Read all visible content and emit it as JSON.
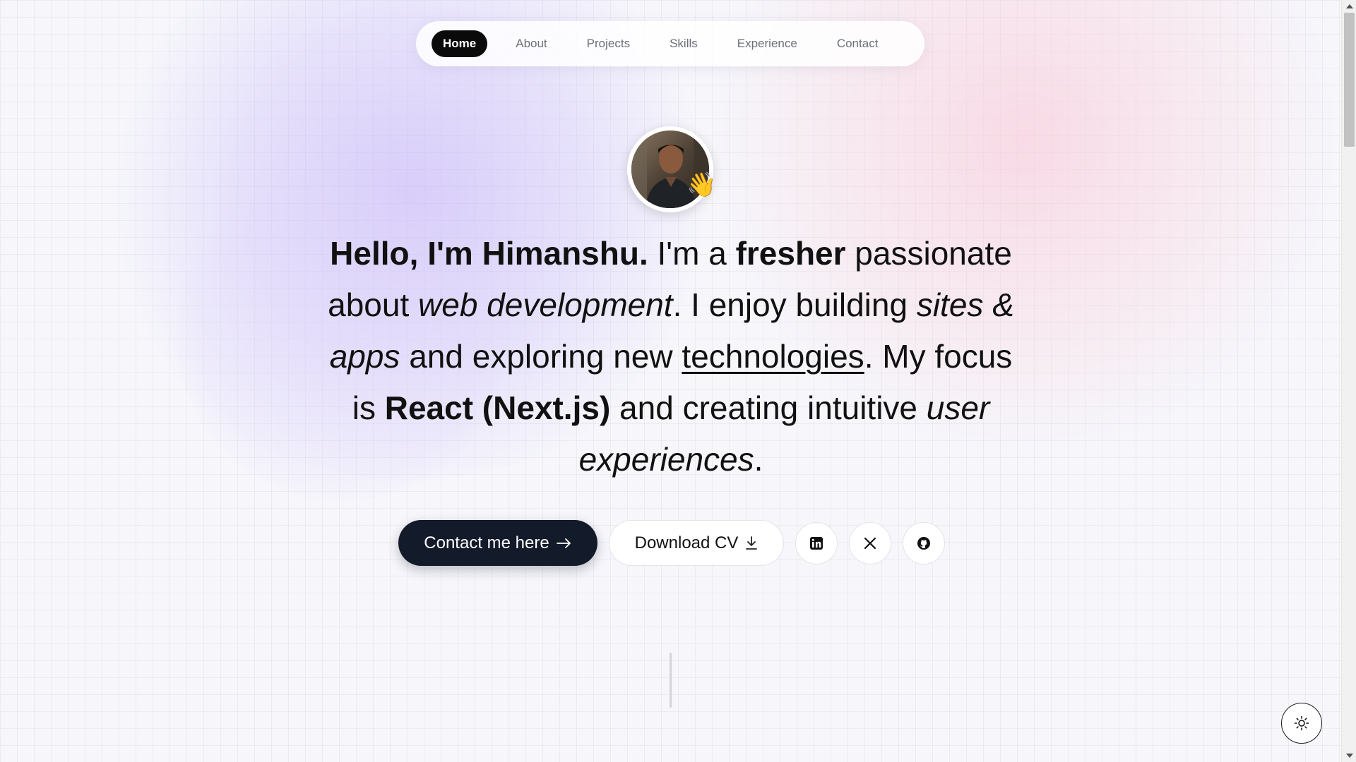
{
  "nav": {
    "items": [
      {
        "label": "Home",
        "active": true
      },
      {
        "label": "About",
        "active": false
      },
      {
        "label": "Projects",
        "active": false
      },
      {
        "label": "Skills",
        "active": false
      },
      {
        "label": "Experience",
        "active": false
      },
      {
        "label": "Contact",
        "active": false
      }
    ]
  },
  "hero": {
    "avatar_emoji": "👋",
    "segments": {
      "s1": "Hello, I'm Himanshu.",
      "s2": " I'm a ",
      "s3": "fresher",
      "s4": " passionate about ",
      "s5": "web development",
      "s6": ". I enjoy building ",
      "s7": "sites & apps",
      "s8": " and exploring new ",
      "s9": "technologies",
      "s10": ". My focus is ",
      "s11": "React (Next.js)",
      "s12": " and creating intuitive ",
      "s13": "user experiences",
      "s14": "."
    }
  },
  "actions": {
    "contact_label": "Contact me here",
    "download_label": "Download CV",
    "contact_icon": "arrow-right-icon",
    "download_icon": "download-icon",
    "social_icons": [
      "linkedin-icon",
      "x-icon",
      "github-icon"
    ]
  },
  "theme_toggle": {
    "icon": "sun-icon"
  },
  "colors": {
    "primary_dark": "#131a2a",
    "nav_active_bg": "#0a0a0a",
    "nav_text": "#6b6f78",
    "background": "#f6f6fb"
  }
}
